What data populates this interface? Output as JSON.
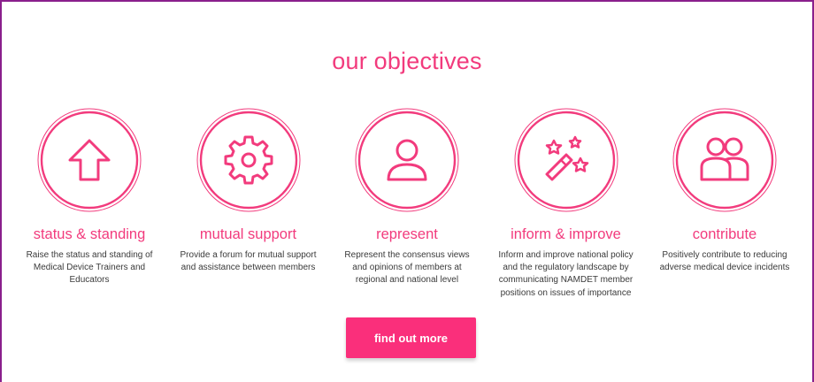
{
  "section": {
    "title": "our objectives",
    "accent_color": "#f23b7d",
    "frame_color": "#8a1f8c"
  },
  "objectives": [
    {
      "icon": "arrow-up-icon",
      "title": "status & standing",
      "description": "Raise the status and standing of Medical Device Trainers and Educators"
    },
    {
      "icon": "gear-icon",
      "title": "mutual support",
      "description": "Provide a forum for mutual support and assistance between members"
    },
    {
      "icon": "user-icon",
      "title": "represent",
      "description": "Represent the consensus views and opinions of members at regional and national level"
    },
    {
      "icon": "magic-wand-icon",
      "title": "inform & improve",
      "description": "Inform and improve national policy and the regulatory landscape by communicating NAMDET member positions on issues of importance"
    },
    {
      "icon": "users-icon",
      "title": "contribute",
      "description": "Positively contribute to reducing adverse medical device incidents"
    }
  ],
  "cta": {
    "label": "find out more",
    "color": "#fa2f7b"
  }
}
